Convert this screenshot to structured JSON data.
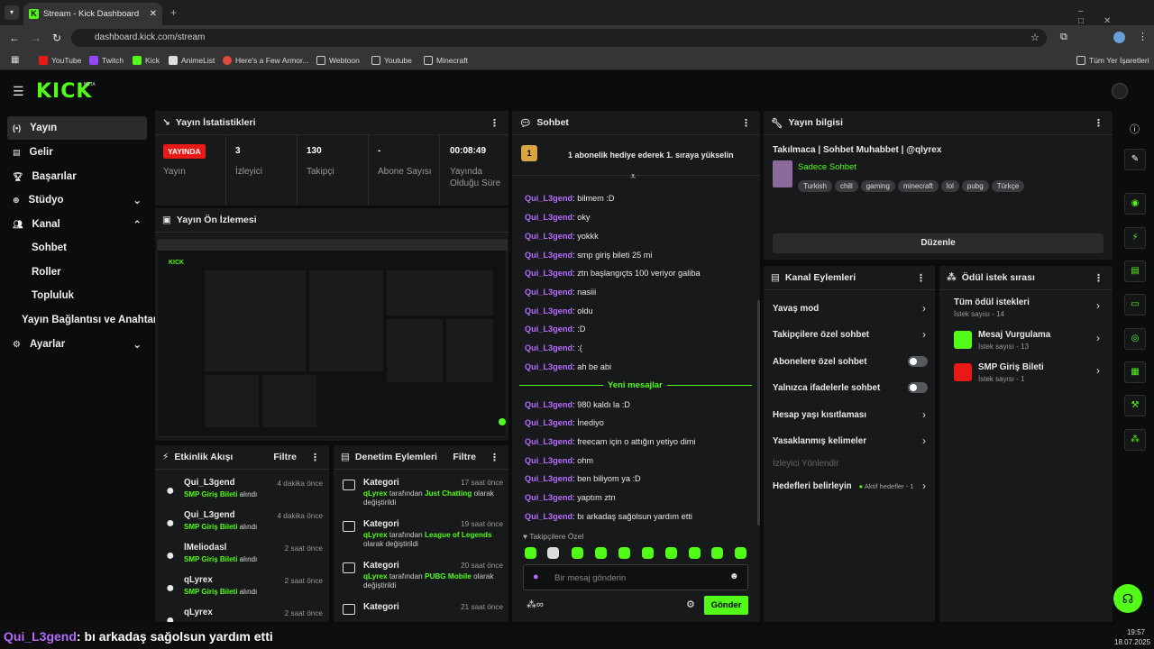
{
  "browser": {
    "tab_title": "Stream - Kick Dashboard",
    "url": "dashboard.kick.com/stream",
    "bookmarks": [
      "YouTube",
      "Twitch",
      "Kick",
      "AnimeList",
      "Here's a Few Armor...",
      "Webtoon",
      "Youtube",
      "Minecraft"
    ],
    "all_bookmarks": "Tüm Yer İşaretleri"
  },
  "brand": {
    "logo": "KICK",
    "beta": "BETA",
    "accent": "#53fc18"
  },
  "sidebar": {
    "items": [
      "Yayın",
      "Gelir",
      "Başarılar",
      "Stüdyo",
      "Kanal"
    ],
    "sub": [
      "Sohbet",
      "Roller",
      "Topluluk",
      "Yayın Bağlantısı ve Anahtarı"
    ],
    "settings": "Ayarlar"
  },
  "stats": {
    "title": "Yayın İstatistikleri",
    "live_badge": "YAYINDA",
    "live_label": "Yayın",
    "viewers": "3",
    "viewers_label": "İzleyici",
    "followers": "130",
    "followers_label": "Takipçi",
    "subs": "-",
    "subs_label": "Abone Sayısı",
    "uptime": "00:08:49",
    "uptime_label": "Yayında Olduğu Süre"
  },
  "preview": {
    "title": "Yayın Ön İzlemesi"
  },
  "activity": {
    "title": "Etkinlik Akışı",
    "filter": "Filtre",
    "events": [
      {
        "name": "Qui_L3gend",
        "time": "4 dakika önce",
        "reward": "SMP Giriş Bileti",
        "suffix": "alındı"
      },
      {
        "name": "Qui_L3gend",
        "time": "4 dakika önce",
        "reward": "SMP Giriş Bileti",
        "suffix": "alındı"
      },
      {
        "name": "lMeliodasl",
        "time": "2 saat önce",
        "reward": "SMP Giriş Bileti",
        "suffix": "alındı"
      },
      {
        "name": "qLyrex",
        "time": "2 saat önce",
        "reward": "SMP Giriş Bileti",
        "suffix": "alındı"
      },
      {
        "name": "qLyrex",
        "time": "2 saat önce",
        "reward": "",
        "suffix": ""
      }
    ]
  },
  "moderation": {
    "title": "Denetim Eylemleri",
    "filter": "Filtre",
    "items": [
      {
        "name": "Kategori",
        "time": "17 saat önce",
        "by": "qLyrex",
        "mid": "tarafından",
        "cat": "Just Chatting",
        "end": "olarak değiştirildi"
      },
      {
        "name": "Kategori",
        "time": "19 saat önce",
        "by": "qLyrex",
        "mid": "tarafından",
        "cat": "League of Legends",
        "end": "olarak değiştirildi"
      },
      {
        "name": "Kategori",
        "time": "20 saat önce",
        "by": "qLyrex",
        "mid": "tarafından",
        "cat": "PUBG Mobile",
        "end": "olarak değiştirildi"
      },
      {
        "name": "Kategori",
        "time": "21 saat önce",
        "by": "",
        "mid": "",
        "cat": "",
        "end": ""
      }
    ]
  },
  "chat": {
    "title": "Sohbet",
    "pinned": "1 abonelik hediye ederek 1. sıraya yükselin",
    "pinned_rank": "1",
    "messages": [
      [
        "Qui_L3gend",
        "bilmem :D"
      ],
      [
        "Qui_L3gend",
        "oky"
      ],
      [
        "Qui_L3gend",
        "yokkk"
      ],
      [
        "Qui_L3gend",
        "smp giriş bileti 25 mi"
      ],
      [
        "Qui_L3gend",
        "ztn başlangıçts 100 veriyor galiba"
      ],
      [
        "Qui_L3gend",
        "nasiii"
      ],
      [
        "Qui_L3gend",
        "oldu"
      ],
      [
        "Qui_L3gend",
        ":D"
      ],
      [
        "Qui_L3gend",
        ":("
      ],
      [
        "Qui_L3gend",
        "ah be abi"
      ]
    ],
    "new_label": "Yeni mesajlar",
    "new_messages": [
      [
        "Qui_L3gend",
        "980 kaldı la :D"
      ],
      [
        "Qui_L3gend",
        "İnediyo"
      ],
      [
        "Qui_L3gend",
        "freecam için o attığın yetiyo dimi"
      ],
      [
        "Qui_L3gend",
        "ohm"
      ],
      [
        "Qui_L3gend",
        "ben biliyom ya :D"
      ],
      [
        "Qui_L3gend",
        "yaptım ztn"
      ],
      [
        "Qui_L3gend",
        "bı arkadaş sağolsun yardım etti"
      ]
    ],
    "followers_only": "Takipçilere Özel",
    "placeholder": "Bir mesaj gönderin",
    "send": "Gönder"
  },
  "info": {
    "title": "Yayın bilgisi",
    "stream_title": "Takılmaca | Sohbet Muhabbet | @qlyrex",
    "category": "Sadece Sohbet",
    "tags": [
      "Turkish",
      "chill",
      "gaming",
      "minecraft",
      "lol",
      "pubg",
      "Türkçe"
    ],
    "edit": "Düzenle"
  },
  "channel": {
    "title": "Kanal Eylemleri",
    "items": [
      "Yavaş mod",
      "Takipçilere özel sohbet",
      "Abonelere özel sohbet",
      "Yalnızca ifadelerle sohbet",
      "Hesap yaşı kısıtlaması",
      "Yasaklanmış kelimeler",
      "İzleyici Yönlendir",
      "Hedefleri belirleyin"
    ],
    "goals_active": "Aktif hedefler - 1"
  },
  "rewards": {
    "title": "Ödül istek sırası",
    "all": "Tüm ödül istekleri",
    "all_count": "İstek sayısı - 14",
    "items": [
      {
        "name": "Mesaj Vurgulama",
        "count": "İstek sayısı - 13",
        "color": "#53fc18"
      },
      {
        "name": "SMP Giriş Bileti",
        "count": "İstek sayısı - 1",
        "color": "#e91916"
      }
    ]
  },
  "overlay": {
    "user": "Qui_L3gend",
    "text": ": bı arkadaş sağolsun yardım etti"
  },
  "taskbar": {
    "time": "19:57",
    "date": "18.07.2025"
  }
}
